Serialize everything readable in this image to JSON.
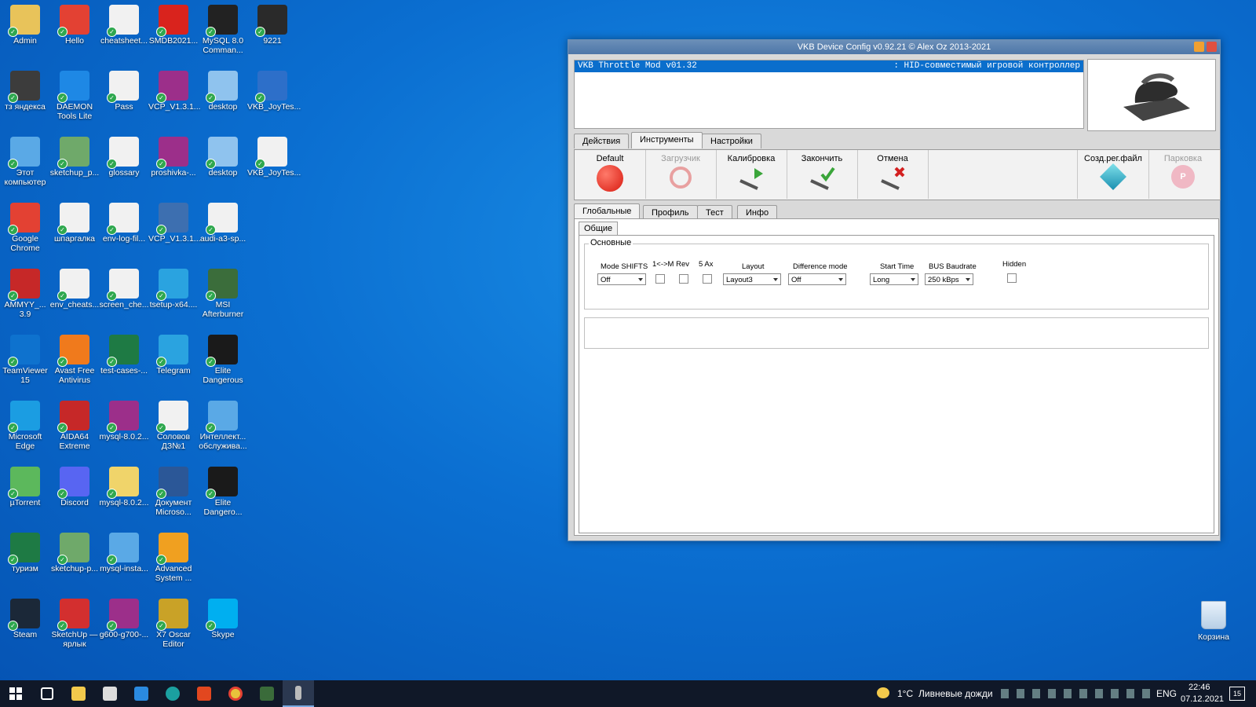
{
  "desktop_icons": [
    {
      "label": "Admin",
      "color": "#e8c35a",
      "col": 0,
      "row": 0
    },
    {
      "label": "Hello",
      "color": "#e34133",
      "col": 1,
      "row": 0
    },
    {
      "label": "cheatsheet...",
      "color": "#f1f1f1",
      "col": 2,
      "row": 0
    },
    {
      "label": "SMDB2021...",
      "color": "#d9231d",
      "col": 3,
      "row": 0
    },
    {
      "label": "MySQL 8.0 Comman...",
      "color": "#222222",
      "col": 4,
      "row": 0
    },
    {
      "label": "9221",
      "color": "#2a2a2a",
      "col": 5,
      "row": 0
    },
    {
      "label": "тз яндекса",
      "color": "#3c3c3c",
      "col": 0,
      "row": 1
    },
    {
      "label": "DAEMON Tools Lite",
      "color": "#1e88e5",
      "col": 1,
      "row": 1
    },
    {
      "label": "Pass",
      "color": "#f1f1f1",
      "col": 2,
      "row": 1
    },
    {
      "label": "VCP_V1.3.1...",
      "color": "#9c2f8a",
      "col": 3,
      "row": 1
    },
    {
      "label": "desktop",
      "color": "#8fc3ee",
      "col": 4,
      "row": 1
    },
    {
      "label": "VKB_JoyTes...",
      "color": "#2d6fc9",
      "col": 5,
      "row": 1
    },
    {
      "label": "Этот компьютер",
      "color": "#5aa9e6",
      "col": 0,
      "row": 2
    },
    {
      "label": "sketchup_p...",
      "color": "#6fa96a",
      "col": 1,
      "row": 2
    },
    {
      "label": "glossary",
      "color": "#f1f1f1",
      "col": 2,
      "row": 2
    },
    {
      "label": "proshivka-...",
      "color": "#9c2f8a",
      "col": 3,
      "row": 2
    },
    {
      "label": "desktop",
      "color": "#8fc3ee",
      "col": 4,
      "row": 2
    },
    {
      "label": "VKB_JoyTes...",
      "color": "#f1f1f1",
      "col": 5,
      "row": 2
    },
    {
      "label": "Google Chrome",
      "color": "#e34133",
      "col": 0,
      "row": 3
    },
    {
      "label": "шпаргалка",
      "color": "#f1f1f1",
      "col": 1,
      "row": 3
    },
    {
      "label": "env-log-fil...",
      "color": "#f1f1f1",
      "col": 2,
      "row": 3
    },
    {
      "label": "VCP_V1.3.1...",
      "color": "#3d6fb0",
      "col": 3,
      "row": 3
    },
    {
      "label": "audi-a3-sp...",
      "color": "#f1f1f1",
      "col": 4,
      "row": 3
    },
    {
      "label": "AMMYY_... 3.9",
      "color": "#c62828",
      "col": 0,
      "row": 4
    },
    {
      "label": "env_cheats...",
      "color": "#f1f1f1",
      "col": 1,
      "row": 4
    },
    {
      "label": "screen_che...",
      "color": "#f1f1f1",
      "col": 2,
      "row": 4
    },
    {
      "label": "tsetup-x64....",
      "color": "#2aa3e0",
      "col": 3,
      "row": 4
    },
    {
      "label": "MSI Afterburner",
      "color": "#3b6d3b",
      "col": 4,
      "row": 4
    },
    {
      "label": "TeamViewer 15",
      "color": "#0e72ce",
      "col": 0,
      "row": 5
    },
    {
      "label": "Avast Free Antivirus",
      "color": "#f07a1c",
      "col": 1,
      "row": 5
    },
    {
      "label": "test-cases-...",
      "color": "#1e7a44",
      "col": 2,
      "row": 5
    },
    {
      "label": "Telegram",
      "color": "#2aa3e0",
      "col": 3,
      "row": 5
    },
    {
      "label": "Elite Dangerous",
      "color": "#1a1a1a",
      "col": 4,
      "row": 5
    },
    {
      "label": "Microsoft Edge",
      "color": "#1b9de2",
      "col": 0,
      "row": 6
    },
    {
      "label": "AIDA64 Extreme",
      "color": "#c62828",
      "col": 1,
      "row": 6
    },
    {
      "label": "mysql-8.0.2...",
      "color": "#9c2f8a",
      "col": 2,
      "row": 6
    },
    {
      "label": "Соловов ДЗ№1",
      "color": "#f1f1f1",
      "col": 3,
      "row": 6
    },
    {
      "label": "Интеллект... обслужива...",
      "color": "#5aa9e6",
      "col": 4,
      "row": 6
    },
    {
      "label": "µTorrent",
      "color": "#5cb85c",
      "col": 0,
      "row": 7
    },
    {
      "label": "Discord",
      "color": "#5865f2",
      "col": 1,
      "row": 7
    },
    {
      "label": "mysql-8.0.2...",
      "color": "#f0d46a",
      "col": 2,
      "row": 7
    },
    {
      "label": "Документ Microso...",
      "color": "#2b5797",
      "col": 3,
      "row": 7
    },
    {
      "label": "Elite Dangero...",
      "color": "#1a1a1a",
      "col": 4,
      "row": 7
    },
    {
      "label": "туризм",
      "color": "#1e7a44",
      "col": 0,
      "row": 8
    },
    {
      "label": "sketchup-p...",
      "color": "#6fa96a",
      "col": 1,
      "row": 8
    },
    {
      "label": "mysql-insta...",
      "color": "#5aa9e6",
      "col": 2,
      "row": 8
    },
    {
      "label": "Advanced System ...",
      "color": "#f0a020",
      "col": 3,
      "row": 8
    },
    {
      "label": "Steam",
      "color": "#1b2838",
      "col": 0,
      "row": 9
    },
    {
      "label": "SketchUp — ярлык",
      "color": "#d32f2f",
      "col": 1,
      "row": 9
    },
    {
      "label": "g600-g700-...",
      "color": "#9c2f8a",
      "col": 2,
      "row": 9
    },
    {
      "label": "X7 Oscar Editor",
      "color": "#c9a227",
      "col": 3,
      "row": 9
    },
    {
      "label": "Skype",
      "color": "#00aff0",
      "col": 4,
      "row": 9
    }
  ],
  "recycle_bin": {
    "label": "Корзина"
  },
  "window": {
    "title": "VKB Device Config v0.92.21  © Alex Oz 2013-2021",
    "device_name": "VKB Throttle Mod v01.32",
    "device_type": ": HID-совместимый игровой контроллер",
    "main_tabs": [
      "Действия",
      "Инструменты",
      "Настройки"
    ],
    "active_main_tab": "Инструменты",
    "tools": [
      {
        "label": "Default"
      },
      {
        "label": "Загрузчик"
      },
      {
        "label": "Калибровка"
      },
      {
        "label": "Закончить"
      },
      {
        "label": "Отмена"
      },
      {
        "label": "Созд.рег.файл"
      },
      {
        "label": "Парковка"
      }
    ],
    "sub_tabs": [
      "Глобальные",
      "Профиль",
      "Тест",
      "Инфо"
    ],
    "active_sub_tab": "Глобальные",
    "inner_tab": "Общие",
    "group_title": "Основные",
    "fields": {
      "mode_shifts": {
        "label": "Mode SHIFTS",
        "value": "Off"
      },
      "m_rev": {
        "label": "1<->M Rev",
        "checked": false
      },
      "five_ax": {
        "label": "5 Ax",
        "checked": false
      },
      "layout": {
        "label": "Layout",
        "value": "Layout3"
      },
      "difference_mode": {
        "label": "Difference mode",
        "value": "Off"
      },
      "start_time": {
        "label": "Start Time",
        "value": "Long"
      },
      "bus_baudrate": {
        "label": "BUS Baudrate",
        "value": "250 kBps"
      },
      "hidden": {
        "label": "Hidden",
        "checked": false
      }
    }
  },
  "taskbar": {
    "weather_temp": "1°C",
    "weather_text": "Ливневые дожди",
    "language": "ENG",
    "time": "22:46",
    "date": "07.12.2021",
    "notification_count": "15"
  },
  "colors": {
    "accent": "#0a6ecc",
    "taskbar": "#101828"
  }
}
